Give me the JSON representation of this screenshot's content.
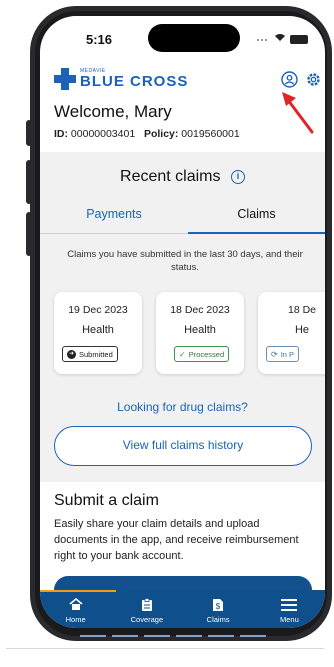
{
  "status_bar": {
    "time": "5:16"
  },
  "header": {
    "logo_small": "MEDAVIE",
    "logo_main": "BLUE CROSS",
    "welcome": "Welcome, Mary",
    "id_label": "ID:",
    "id_value": "00000003401",
    "policy_label": "Policy:",
    "policy_value": "0019560001",
    "icons": [
      "profile-icon",
      "gear-icon"
    ]
  },
  "recent_claims": {
    "title": "Recent claims",
    "tabs": [
      {
        "label": "Payments",
        "active": false
      },
      {
        "label": "Claims",
        "active": true
      }
    ],
    "description": "Claims you have submitted in the last 30 days, and their status.",
    "cards": [
      {
        "date": "19 Dec 2023",
        "type": "Health",
        "status": "Submitted"
      },
      {
        "date": "18 Dec 2023",
        "type": "Health",
        "status": "Processed"
      },
      {
        "date": "18 De",
        "type": "He",
        "status": "In P"
      }
    ],
    "drug_link": "Looking for drug claims?",
    "history_button": "View full claims history"
  },
  "submit_claim": {
    "title": "Submit a claim",
    "description": "Easily share your claim details and upload documents in the app, and receive reimbursement right to your bank account."
  },
  "bottom_nav": {
    "items": [
      {
        "label": "Home",
        "icon": "home-icon"
      },
      {
        "label": "Coverage",
        "icon": "coverage-icon"
      },
      {
        "label": "Claims",
        "icon": "claims-icon"
      },
      {
        "label": "Menu",
        "icon": "menu-icon"
      }
    ]
  },
  "colors": {
    "brand_blue": "#1a63b8",
    "nav_blue": "#0f4f8b",
    "accent_orange": "#f39a1e",
    "processed_green": "#3a9a4a",
    "annotation_arrow": "#e0242a"
  }
}
